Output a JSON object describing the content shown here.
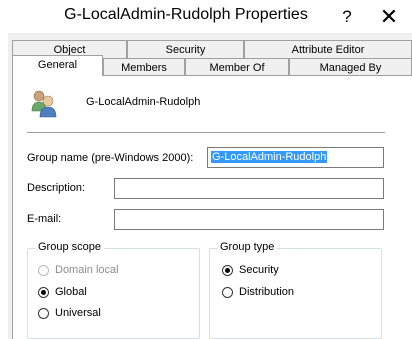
{
  "window": {
    "title": "G-LocalAdmin-Rudolph Properties",
    "help_label": "?",
    "close_label": "✕"
  },
  "tabs": {
    "row1": [
      "Object",
      "Security",
      "Attribute Editor"
    ],
    "row2": [
      "General",
      "Members",
      "Member Of",
      "Managed By"
    ],
    "active": "General"
  },
  "general": {
    "group_display_name": "G-LocalAdmin-Rudolph",
    "icon": "group-users-icon",
    "fields": {
      "group_name_label": "Group name (pre-Windows 2000):",
      "group_name_value": "G-LocalAdmin-Rudolph",
      "description_label": "Description:",
      "description_value": "",
      "email_label": "E-mail:",
      "email_value": ""
    },
    "group_scope": {
      "title": "Group scope",
      "options": [
        "Domain local",
        "Global",
        "Universal"
      ],
      "selected": "Global",
      "disabled": [
        "Domain local"
      ]
    },
    "group_type": {
      "title": "Group type",
      "options": [
        "Security",
        "Distribution"
      ],
      "selected": "Security"
    }
  }
}
